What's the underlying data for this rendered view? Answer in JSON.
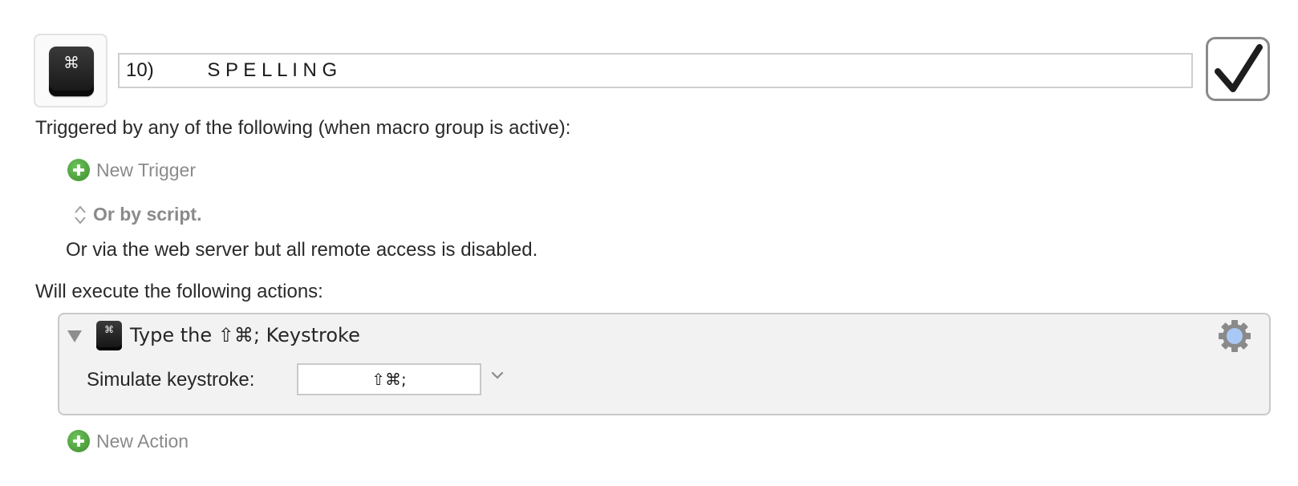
{
  "macro": {
    "icon_glyph": "⌘",
    "name": "10)          S P E L L I N G",
    "enabled": true
  },
  "triggers": {
    "heading": "Triggered by any of the following (when macro group is active):",
    "new_trigger_label": "New Trigger",
    "script_label": "Or by script.",
    "web_server_text": "Or via the web server but all remote access is disabled."
  },
  "actions": {
    "heading": "Will execute the following actions:",
    "items": [
      {
        "icon_glyph": "⌘",
        "title": "Type the ⇧⌘; Keystroke",
        "simulate_label": "Simulate keystroke:",
        "keystroke_value": "⇧⌘;"
      }
    ],
    "new_action_label": "New Action"
  },
  "colors": {
    "add_green": "#4aa23a",
    "muted_text": "#8a8a8a",
    "gear_center": "#a9c8f5"
  },
  "icons": [
    "keycap-icon",
    "checkmark-icon",
    "plus-circle-icon",
    "up-down-arrows-icon",
    "disclosure-triangle-icon",
    "gear-icon",
    "chevron-down-icon"
  ]
}
